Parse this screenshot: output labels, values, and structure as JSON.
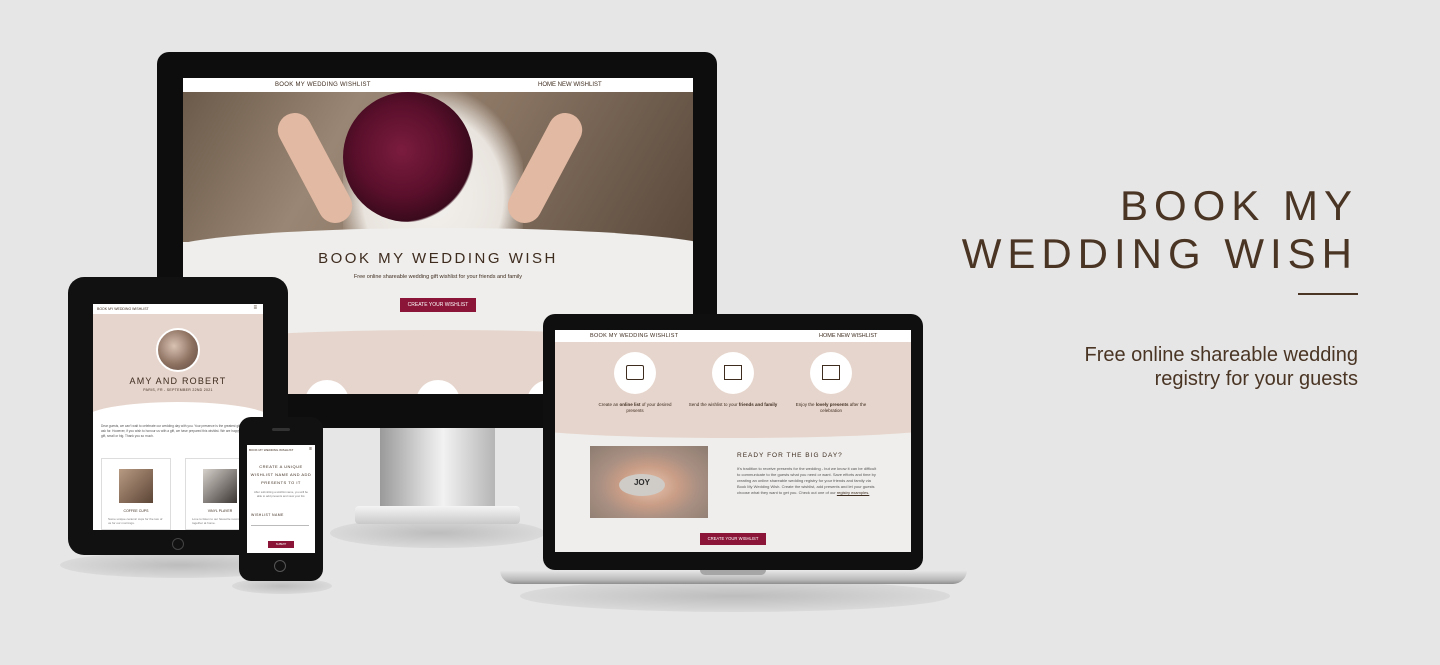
{
  "hero": {
    "title_line1": "BOOK MY",
    "title_line2": "WEDDING WISH",
    "subtitle_line1": "Free online shareable wedding",
    "subtitle_line2": "registry for your guests"
  },
  "desktop": {
    "nav_brand": "BOOK MY WEDDING WISHLIST",
    "nav_links": "HOME   NEW WISHLIST",
    "title": "BOOK MY WEDDING WISH",
    "tagline": "Free online shareable wedding gift wishlist for your friends and family",
    "cta": "CREATE YOUR WISHLIST"
  },
  "tablet": {
    "nav_brand": "BOOK MY WEDDING WISHLIST",
    "menu_icon": "≡",
    "couple": "AMY AND ROBERT",
    "location": "PARIS, FR - SEPTEMBER 22ND 2021",
    "message": "Dear guests, we can't wait to celebrate our wedding day with you. Your presence is the greatest gift we could ask for. However, if you wish to honour us with a gift, we have prepared this wishlist. We are happy with any gift, small or big. Thank you so much.",
    "cards": [
      {
        "label": "COFFEE CUPS",
        "desc": "Some unique ceramic cups for the two of us for our mornings."
      },
      {
        "label": "VINYL PLAYER",
        "desc": "Love to listen to our favourite records together at home."
      }
    ]
  },
  "phone": {
    "nav_brand": "BOOK MY WEDDING WISHLIST",
    "menu_icon": "≡",
    "heading": "CREATE A UNIQUE WISHLIST NAME AND ADD PRESENTS TO IT",
    "text": "After submitting a wishlist name, you will be able to add presents and view your list.",
    "field_label": "WISHLIST NAME",
    "button": "SUBMIT"
  },
  "laptop": {
    "nav_brand": "BOOK MY WEDDING WISHLIST",
    "nav_links": "HOME   NEW WISHLIST",
    "steps": [
      {
        "pre": "Create an ",
        "bold": "online list",
        "post": " of your desired presents"
      },
      {
        "pre": "Send the wishlist to your ",
        "bold": "friends and family",
        "post": ""
      },
      {
        "pre": "Enjoy the ",
        "bold": "lovely presents",
        "post": " after the celebration"
      }
    ],
    "photo_text": "JOY",
    "ready_title": "READY FOR THE BIG DAY?",
    "body": "It's tradition to receive presents for the wedding - but we know it can be difficult to communicate to the guests what you need or want. Save efforts and time by creating an online shareable wedding registry for your friends and family via Book My Wedding Wish. Create the wishlist, add presents and let your guests choose what they want to get you. Check out one of our ",
    "body_link": "registry examples.",
    "cta": "CREATE YOUR WISHLIST"
  }
}
